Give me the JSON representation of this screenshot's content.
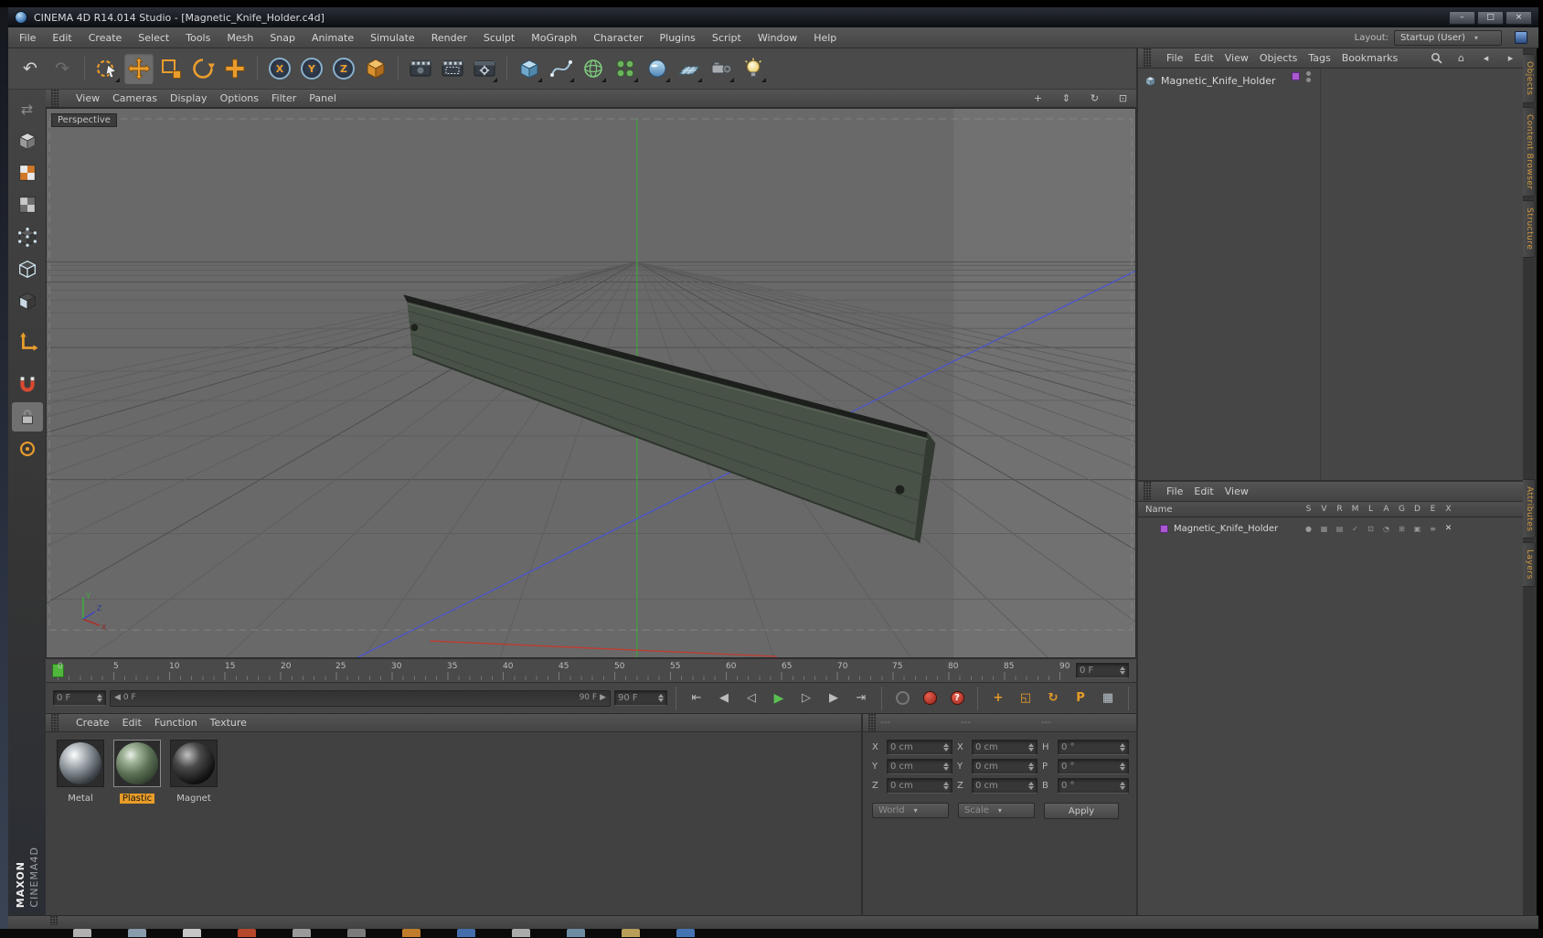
{
  "window": {
    "title": "CINEMA 4D R14.014 Studio - [Magnetic_Knife_Holder.c4d]"
  },
  "icons": {
    "minimize": "–",
    "maximize": "□",
    "close": "×",
    "undo": "↶",
    "redo": "↷",
    "dropdown": "▾",
    "pan": "+",
    "zoom": "⇕",
    "rotate_view": "↻",
    "toggle_view": "⊡",
    "home": "⌂",
    "nav_prev": "◂",
    "nav_next": "▸",
    "goto_start": "⇤",
    "prev_key": "◀",
    "prev_frame": "◁",
    "play": "▶",
    "next_frame": "▷",
    "next_key": "▶",
    "goto_end": "⇥",
    "help": "?",
    "key_position": "+",
    "key_scale": "◱",
    "key_rotation": "↻",
    "key_parameter": "P",
    "key_pla": "▦",
    "autokey": "◉",
    "range_left": "◀",
    "range_right": "▶",
    "make_editable": "⇄"
  },
  "menu_bar": {
    "items": [
      "File",
      "Edit",
      "Create",
      "Select",
      "Tools",
      "Mesh",
      "Snap",
      "Animate",
      "Simulate",
      "Render",
      "Sculpt",
      "MoGraph",
      "Character",
      "Plugins",
      "Script",
      "Window",
      "Help"
    ],
    "layout_label": "Layout:",
    "layout_value": "Startup (User)"
  },
  "toolbar": {
    "axis_locks": [
      "X",
      "Y",
      "Z"
    ]
  },
  "viewport": {
    "menus": [
      "View",
      "Cameras",
      "Display",
      "Options",
      "Filter",
      "Panel"
    ],
    "camera_label": "Perspective",
    "gizmo": {
      "x": "X",
      "y": "Y",
      "z": "Z"
    }
  },
  "timeline": {
    "ticks": [
      "0",
      "5",
      "10",
      "15",
      "20",
      "25",
      "30",
      "35",
      "40",
      "45",
      "50",
      "55",
      "60",
      "65",
      "70",
      "75",
      "80",
      "85",
      "90"
    ],
    "current_frame": "0 F",
    "range_start": "0 F",
    "range_end": "90 F",
    "end_frame": "90 F"
  },
  "materials_panel": {
    "menus": [
      "Create",
      "Edit",
      "Function",
      "Texture"
    ],
    "materials": [
      {
        "name": "Metal"
      },
      {
        "name": "Plastic"
      },
      {
        "name": "Magnet"
      }
    ],
    "selected": "Plastic"
  },
  "coordinates_panel": {
    "headers": [
      "---",
      "---",
      "---"
    ],
    "rows": [
      {
        "pos_label": "X",
        "pos_value": "0 cm",
        "size_label": "X",
        "size_value": "0 cm",
        "rot_label": "H",
        "rot_value": "0 °"
      },
      {
        "pos_label": "Y",
        "pos_value": "0 cm",
        "size_label": "Y",
        "size_value": "0 cm",
        "rot_label": "P",
        "rot_value": "0 °"
      },
      {
        "pos_label": "Z",
        "pos_value": "0 cm",
        "size_label": "Z",
        "size_value": "0 cm",
        "rot_label": "B",
        "rot_value": "0 °"
      }
    ],
    "world": "World",
    "scale": "Scale",
    "apply": "Apply"
  },
  "object_manager": {
    "menus": [
      "File",
      "Edit",
      "View",
      "Objects",
      "Tags",
      "Bookmarks"
    ],
    "objects": [
      {
        "name": "Magnetic_Knife_Holder"
      }
    ]
  },
  "layer_manager": {
    "menus": [
      "File",
      "Edit",
      "View"
    ],
    "name_header": "Name",
    "columns": [
      "S",
      "V",
      "R",
      "M",
      "L",
      "A",
      "G",
      "D",
      "E",
      "X"
    ],
    "rows": [
      {
        "name": "Magnetic_Knife_Holder"
      }
    ],
    "toggle_glyphs": [
      "●",
      "▦",
      "▤",
      "✓",
      "⊡",
      "◔",
      "⊞",
      "▣",
      "≡",
      "✕"
    ]
  },
  "side_tabs": {
    "top": [
      "Objects",
      "Content Browser",
      "Structure"
    ],
    "bottom": [
      "Attributes",
      "Layers"
    ]
  },
  "branding": {
    "line1": "MAXON",
    "line2": "CINEMA4D"
  },
  "colors": {
    "accent": "#e89c28",
    "axis_green": "#3fa03f",
    "axis_blue": "#4a55d0",
    "axis_red": "#c23a2e",
    "layer_swatch": "#a959d1",
    "play_green": "#58c050",
    "record_red": "#c03028",
    "viewport_bg": "#696969"
  }
}
